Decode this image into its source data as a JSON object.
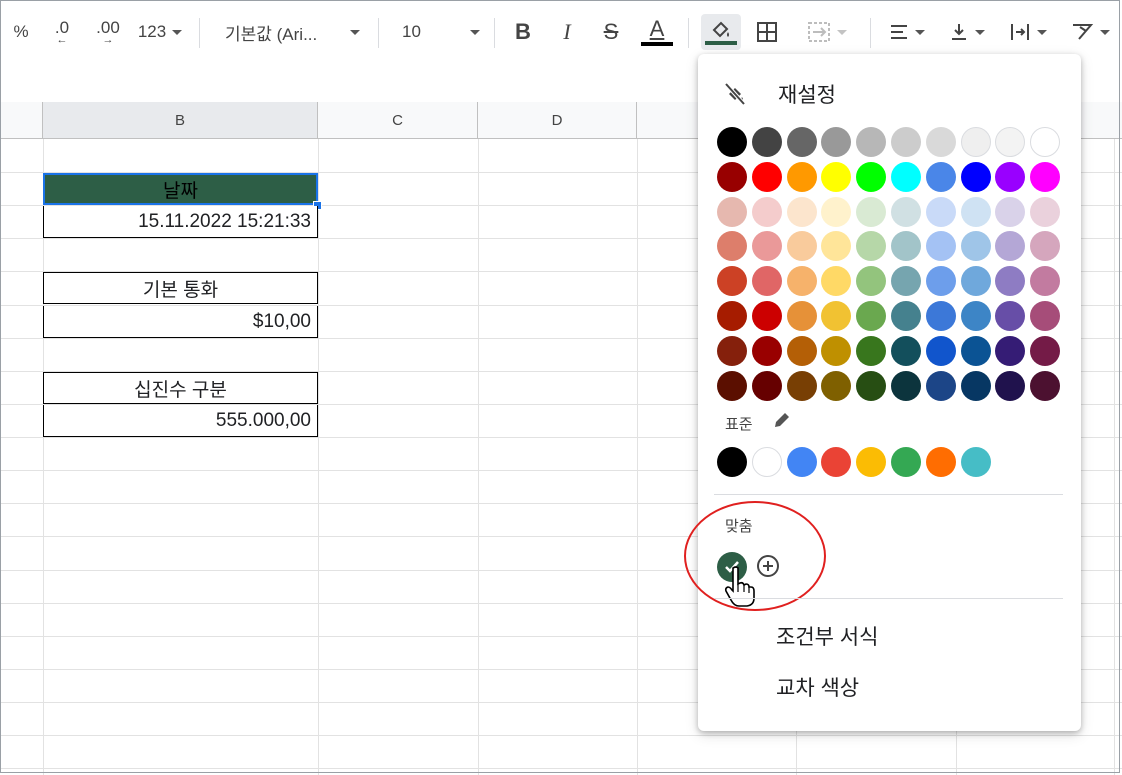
{
  "toolbar": {
    "percent": "%",
    "decrease_decimals": ".0",
    "increase_decimals": ".00",
    "more_formats": "123",
    "font_name": "기본값 (Ari...",
    "font_size": "10",
    "bold": "B",
    "italic": "I",
    "strike": "S",
    "text_color": "A"
  },
  "columns": [
    "B",
    "C",
    "D"
  ],
  "cells": {
    "date_header": "날짜",
    "date_value": "15.11.2022 15:21:33",
    "currency_header": "기본 통화",
    "currency_value": "$10,00",
    "decimal_header": "십진수 구분",
    "decimal_value": "555.000,00"
  },
  "fill_menu": {
    "reset_label": "재설정",
    "standard_label": "표준",
    "custom_label": "맞춤",
    "conditional_format": "조건부 서식",
    "alternating_colors": "교차 색상",
    "custom_color": "#2d5e46",
    "palette": [
      [
        "#000000",
        "#434343",
        "#666666",
        "#999999",
        "#b7b7b7",
        "#cccccc",
        "#d9d9d9",
        "#efefef",
        "#f3f3f3",
        "#ffffff"
      ],
      [
        "#980000",
        "#ff0000",
        "#ff9900",
        "#ffff00",
        "#00ff00",
        "#00ffff",
        "#4a86e8",
        "#0000ff",
        "#9900ff",
        "#ff00ff"
      ],
      [
        "#e6b8af",
        "#f4cccc",
        "#fce5cd",
        "#fff2cc",
        "#d9ead3",
        "#d0e0e3",
        "#c9daf8",
        "#cfe2f3",
        "#d9d2e9",
        "#ead1dc"
      ],
      [
        "#dd7e6b",
        "#ea9999",
        "#f9cb9c",
        "#ffe599",
        "#b6d7a8",
        "#a2c4c9",
        "#a4c2f4",
        "#9fc5e8",
        "#b4a7d6",
        "#d5a6bd"
      ],
      [
        "#cc4125",
        "#e06666",
        "#f6b26b",
        "#ffd966",
        "#93c47d",
        "#76a5af",
        "#6d9eeb",
        "#6fa8dc",
        "#8e7cc3",
        "#c27ba0"
      ],
      [
        "#a61c00",
        "#cc0000",
        "#e69138",
        "#f1c232",
        "#6aa84f",
        "#45818e",
        "#3c78d8",
        "#3d85c6",
        "#674ea7",
        "#a64d79"
      ],
      [
        "#85200c",
        "#990000",
        "#b45f06",
        "#bf9000",
        "#38761d",
        "#134f5c",
        "#1155cc",
        "#0b5394",
        "#351c75",
        "#741b47"
      ],
      [
        "#5b0f00",
        "#660000",
        "#783f04",
        "#7f6000",
        "#274e13",
        "#0c343d",
        "#1c4587",
        "#073763",
        "#20124d",
        "#4c1130"
      ]
    ],
    "standard": [
      "#000000",
      "#ffffff",
      "#4285f4",
      "#ea4335",
      "#fbbc04",
      "#34a853",
      "#ff6d01",
      "#46bdc6"
    ]
  }
}
